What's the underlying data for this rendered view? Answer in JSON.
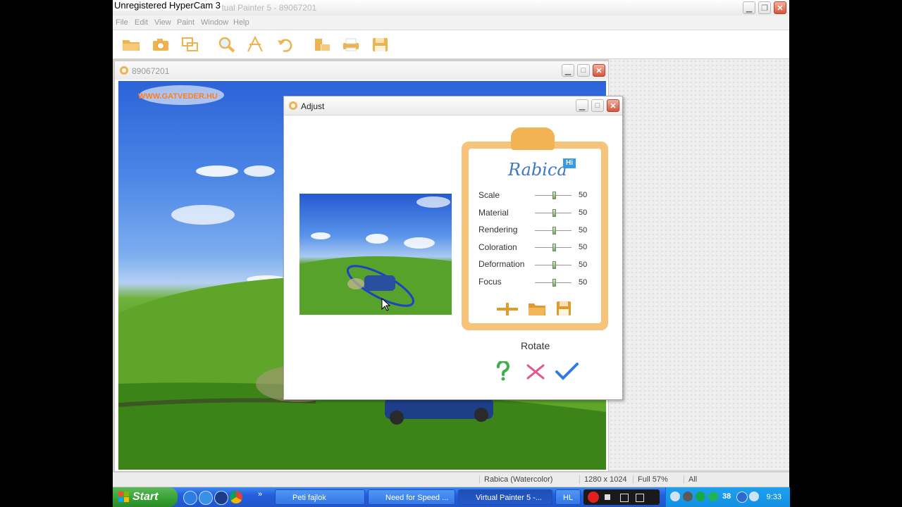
{
  "recorder_watermark": "Unregistered HyperCam 3",
  "app": {
    "title": "Virtual Painter 5 - 89067201"
  },
  "menu": [
    "File",
    "Edit",
    "View",
    "Paint",
    "Window",
    "Help"
  ],
  "toolbar": [
    "open-icon",
    "camera-icon",
    "layers-icon",
    "zoom-icon",
    "paint-icon",
    "undo-icon",
    "arrange-icon",
    "print-icon",
    "save-icon"
  ],
  "document": {
    "title": "89067201",
    "watermark_text": "WWW.GATVEDER.HU"
  },
  "dialog": {
    "title": "Adjust",
    "brand": "Rabica",
    "brand_badge": "Hi",
    "sliders": [
      {
        "label": "Scale",
        "value": "50"
      },
      {
        "label": "Material",
        "value": "50"
      },
      {
        "label": "Rendering",
        "value": "50"
      },
      {
        "label": "Coloration",
        "value": "50"
      },
      {
        "label": "Deformation",
        "value": "50"
      },
      {
        "label": "Focus",
        "value": "50"
      }
    ],
    "rotate_label": "Rotate"
  },
  "status": {
    "style": "Rabica  (Watercolor)",
    "size": "1280 x 1024",
    "zoom": "Full  57%",
    "mode": "All"
  },
  "taskbar": {
    "start": "Start",
    "tasks": [
      "Peti fajlok",
      "Need for Speed ...",
      "Virtual Painter 5 -...",
      "HL"
    ],
    "tray_number": "38",
    "clock": "9:33"
  },
  "colors": {
    "accent_orange": "#f2b453",
    "brand_blue": "#3b78c8",
    "xp_blue": "#245edb",
    "start_green": "#36a033"
  }
}
